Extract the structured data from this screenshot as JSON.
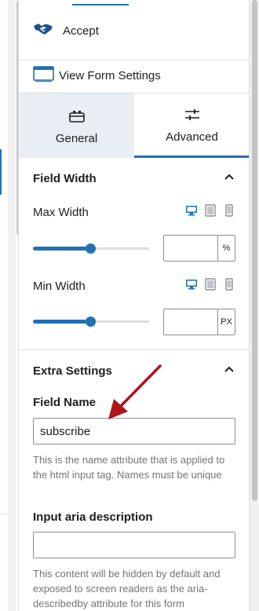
{
  "header": {
    "accept_label": "Accept",
    "view_form_settings_label": "View Form Settings"
  },
  "tabs": [
    {
      "label": "General",
      "icon": "toolbox-icon",
      "active": false
    },
    {
      "label": "Advanced",
      "icon": "sliders-icon",
      "active": true
    }
  ],
  "field_width": {
    "title": "Field Width",
    "max_width": {
      "label": "Max Width",
      "value": "",
      "unit": "%",
      "slider_percent": 50
    },
    "min_width": {
      "label": "Min Width",
      "value": "",
      "unit": "PX",
      "slider_percent": 50
    },
    "devices": [
      "desktop-icon",
      "tablet-icon",
      "mobile-icon"
    ],
    "active_device": "desktop-icon"
  },
  "extra_settings": {
    "title": "Extra Settings",
    "field_name": {
      "label": "Field Name",
      "value": "subscribe",
      "help": "This is the name attribute that is applied to the html input tag. Names must be unique"
    },
    "aria_description": {
      "label": "Input aria description",
      "value": "",
      "help": "This content will be hidden by default and exposed to screen readers as the aria-describedby attribute for this form"
    }
  },
  "colors": {
    "accent": "#2271b1",
    "arrow": "#b0131c",
    "active_tab_bg": "#e8eef4",
    "help_text": "#757575"
  }
}
